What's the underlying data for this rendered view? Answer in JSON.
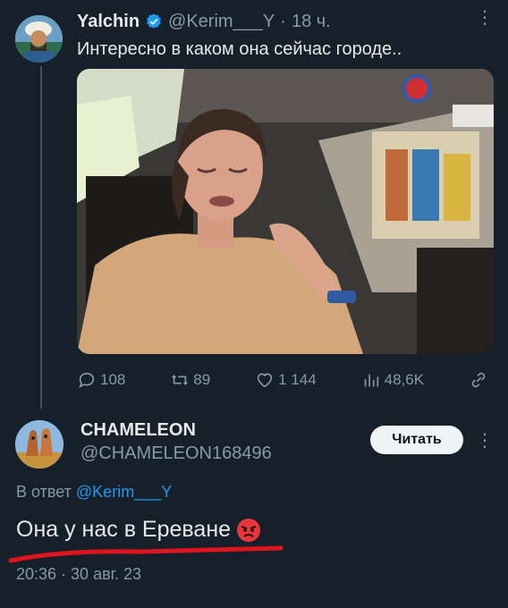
{
  "tweet1": {
    "name": "Yalchin",
    "handle": "@Kerim___Y",
    "separator": "·",
    "time": "18 ч.",
    "text": "Интересно в каком она сейчас городе..",
    "actions": {
      "replies": "108",
      "retweets": "89",
      "likes": "1 144",
      "views": "48,6K"
    }
  },
  "tweet2": {
    "name": "CHAMELEON",
    "handle": "@CHAMELEON168496",
    "follow_label": "Читать",
    "reply_prefix": "В ответ",
    "reply_handle": "@Kerim___Y",
    "text": "Она у нас в Ереване",
    "timestamp": "20:36 · 30 авг. 23"
  },
  "colors": {
    "background": "#15202b",
    "accent": "#1d9bf0",
    "muted": "#8b98a5",
    "underline": "#e0141e"
  },
  "icons": [
    "verified-badge-icon",
    "more-icon",
    "reply-icon",
    "retweet-icon",
    "like-icon",
    "views-icon",
    "share-icon",
    "angry-face-emoji"
  ]
}
